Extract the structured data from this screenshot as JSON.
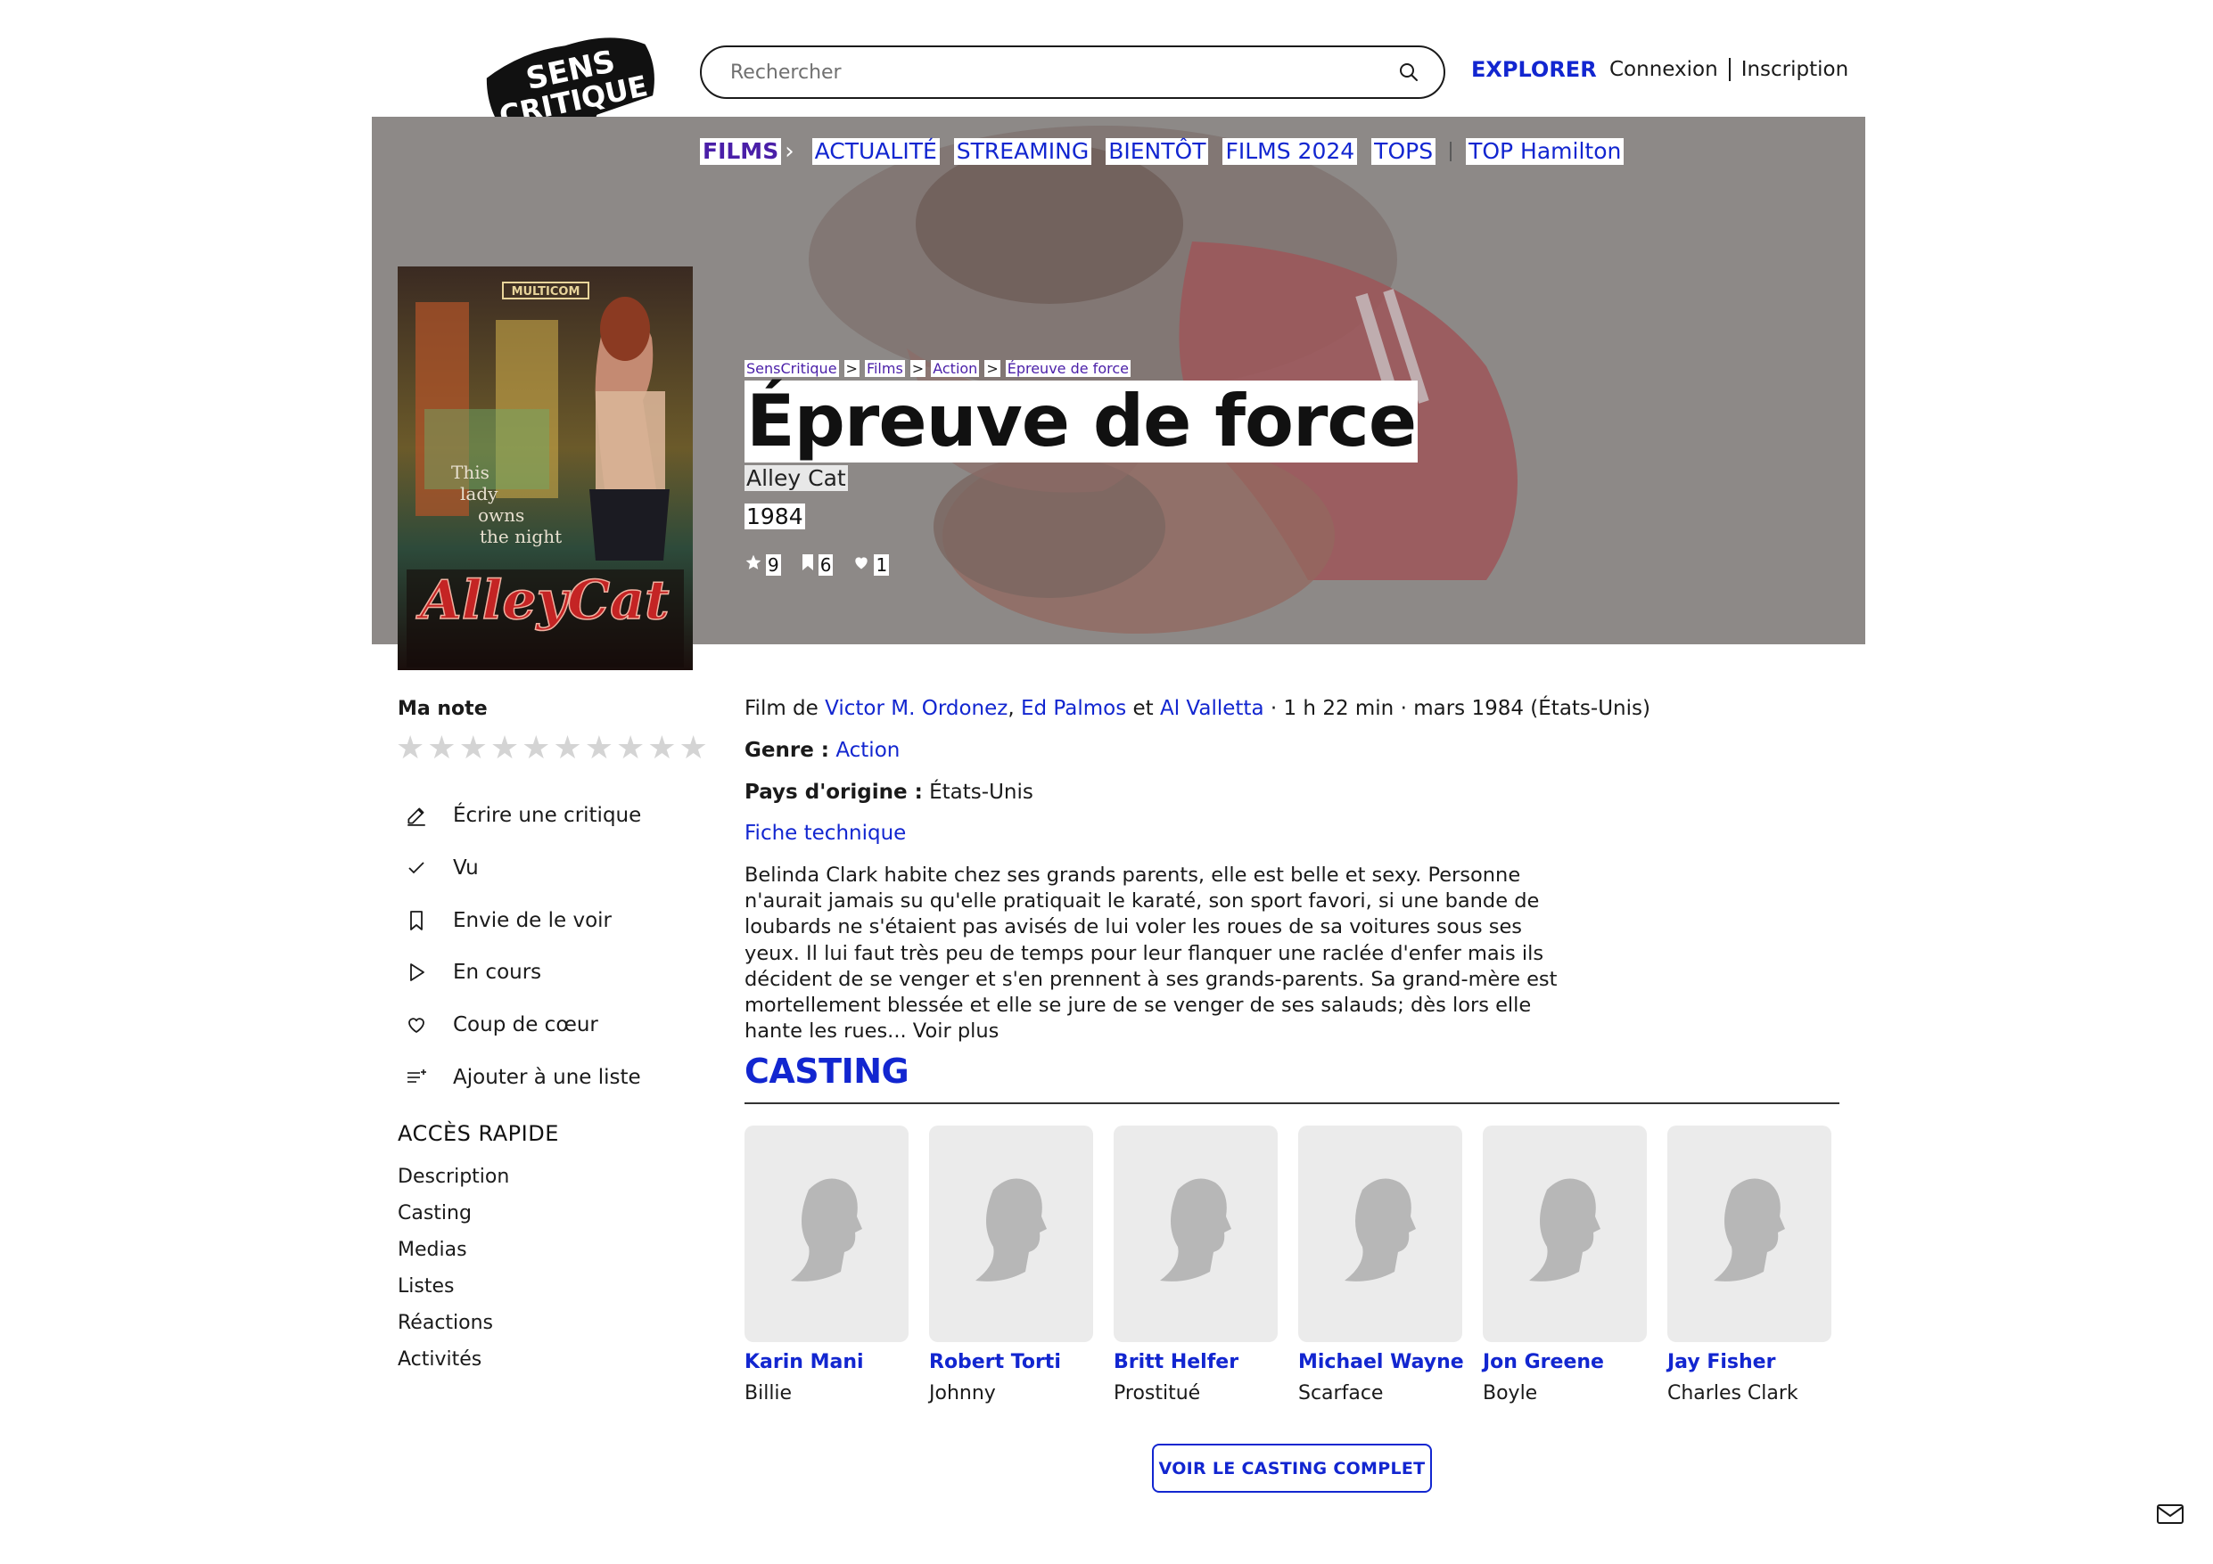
{
  "header": {
    "logo_text_line1": "SENS",
    "logo_text_line2": "CRITIQUE",
    "search_placeholder": "Rechercher",
    "explore_label": "EXPLORER",
    "login_label": "Connexion",
    "signup_label": "Inscription"
  },
  "nav": {
    "items": [
      "FILMS",
      "ACTUALITÉ",
      "STREAMING",
      "BIENTÔT",
      "FILMS 2024",
      "TOPS",
      "TOP Hamilton"
    ]
  },
  "breadcrumb": [
    "SensCritique",
    "Films",
    "Action",
    "Épreuve de force"
  ],
  "movie": {
    "title": "Épreuve de force",
    "original_title": "Alley Cat",
    "year": "1984",
    "stats": {
      "ratings": "9",
      "wishlist": "6",
      "favorites": "1"
    },
    "poster": {
      "studio": "MULTICOM",
      "tagline_1": "This",
      "tagline_2": "lady",
      "tagline_3": "owns",
      "tagline_4": "the night",
      "logo_title": "AlleyCat"
    }
  },
  "sidebar": {
    "my_rating_label": "Ma note",
    "max_stars": 10,
    "actions": [
      {
        "label": "Écrire une critique",
        "icon": "pencil-icon"
      },
      {
        "label": "Vu",
        "icon": "check-icon"
      },
      {
        "label": "Envie de le voir",
        "icon": "bookmark-icon"
      },
      {
        "label": "En cours",
        "icon": "play-icon"
      },
      {
        "label": "Coup de cœur",
        "icon": "heart-icon"
      },
      {
        "label": "Ajouter à une liste",
        "icon": "list-add-icon"
      }
    ],
    "quick_access_title": "ACCÈS RAPIDE",
    "quick_links": [
      "Description",
      "Casting",
      "Medias",
      "Listes",
      "Réactions",
      "Activités"
    ]
  },
  "details": {
    "film_de_prefix": "Film de",
    "directors": [
      "Victor M. Ordonez",
      "Ed Palmos",
      "Al Valletta"
    ],
    "comma": ",",
    "and": "et",
    "meta": "· 1 h 22 min · mars 1984 (États-Unis)",
    "genre_label": "Genre :",
    "genre_value": "Action",
    "country_label": "Pays d'origine :",
    "country_value": "États-Unis",
    "fiche_technique": "Fiche technique",
    "synopsis": "Belinda Clark habite chez ses grands parents, elle est belle et sexy. Personne n'aurait jamais su qu'elle pratiquait le karaté, son sport favori, si une bande de loubards ne s'étaient pas avisés de lui voler les roues de sa voitures sous ses yeux. Il lui faut très peu de temps pour leur flanquer une raclée d'enfer mais ils décident de se venger et s'en prennent à ses grands-parents. Sa grand-mère est mortellement blessée et elle se jure de se venger de ses salauds; dès lors elle hante les rues...",
    "voir_plus": "Voir plus"
  },
  "casting": {
    "title": "CASTING",
    "members": [
      {
        "name": "Karin Mani",
        "role": "Billie"
      },
      {
        "name": "Robert Torti",
        "role": "Johnny"
      },
      {
        "name": "Britt Helfer",
        "role": "Prostitué"
      },
      {
        "name": "Michael Wayne",
        "role": "Scarface"
      },
      {
        "name": "Jon Greene",
        "role": "Boyle"
      },
      {
        "name": "Jay Fisher",
        "role": "Charles Clark"
      }
    ],
    "full_cast_label": "VOIR LE CASTING COMPLET"
  },
  "colors": {
    "accent": "#1226d0",
    "films_nav": "#4a1fa8",
    "hero_bg": "#8c8888"
  }
}
